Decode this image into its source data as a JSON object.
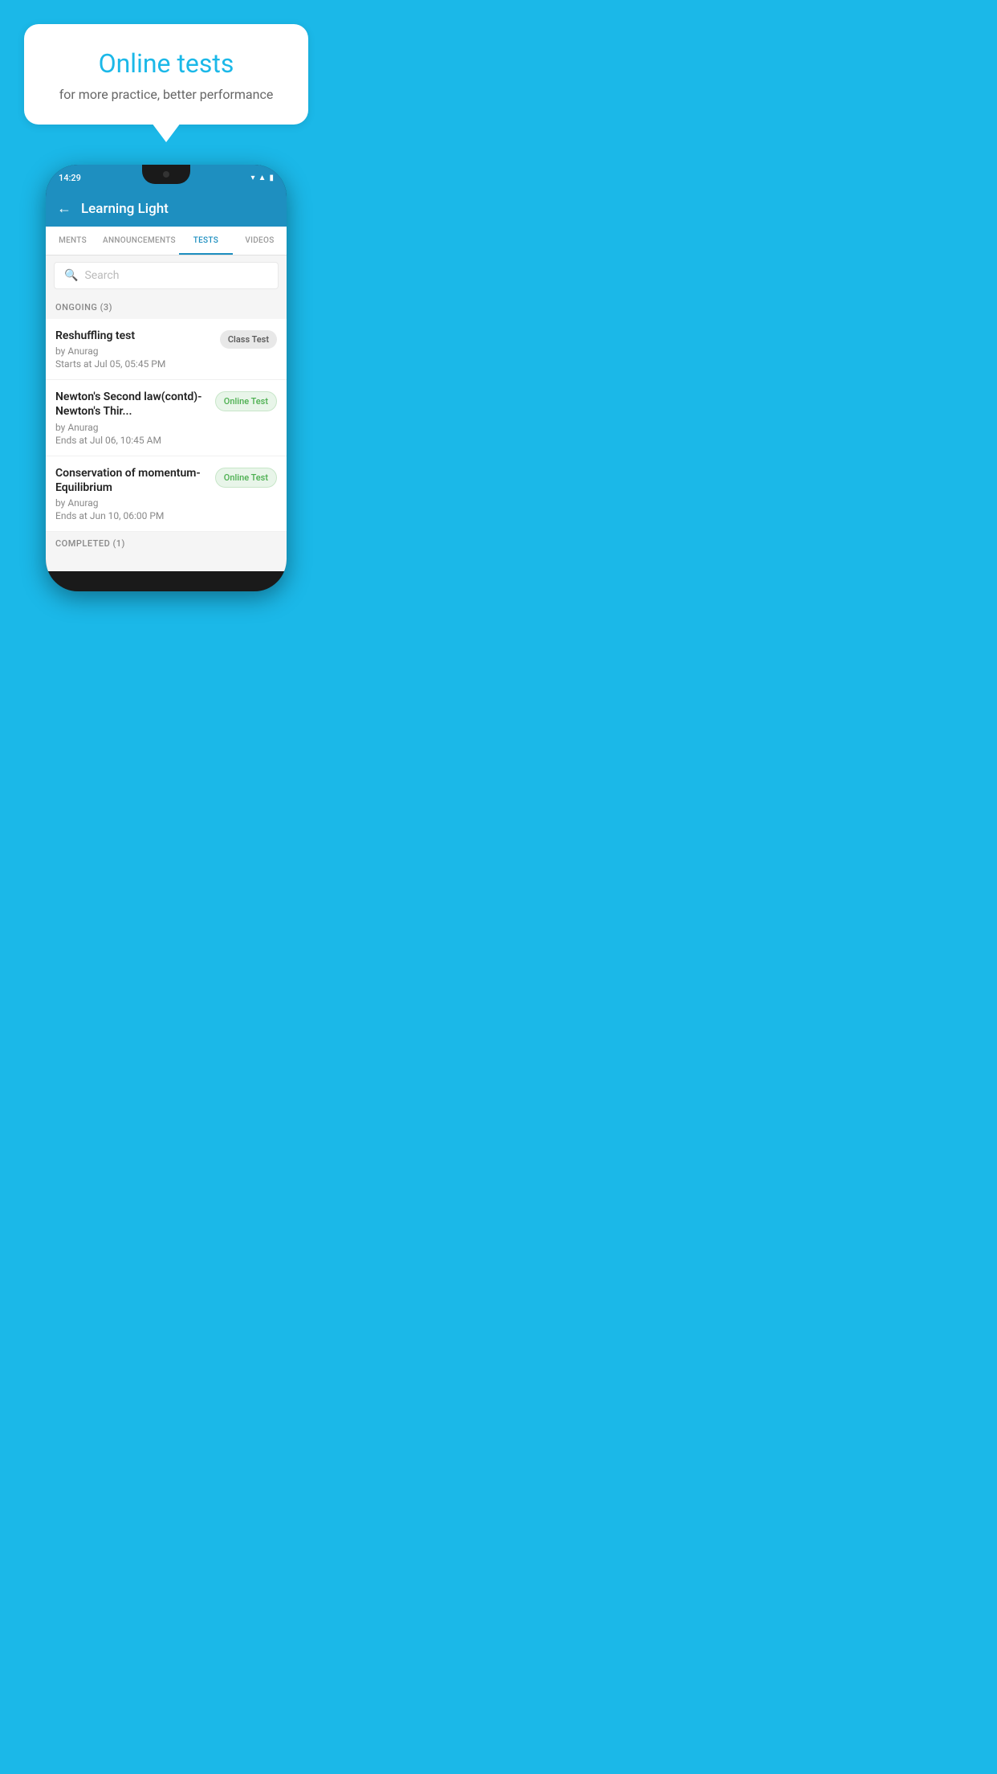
{
  "background": {
    "color": "#1bb8e8"
  },
  "speech_bubble": {
    "title": "Online tests",
    "subtitle": "for more practice, better performance"
  },
  "phone": {
    "status_bar": {
      "time": "14:29",
      "icons": [
        "wifi",
        "signal",
        "battery"
      ]
    },
    "app_bar": {
      "title": "Learning Light",
      "back_label": "←"
    },
    "tabs": [
      {
        "label": "MENTS",
        "active": false
      },
      {
        "label": "ANNOUNCEMENTS",
        "active": false
      },
      {
        "label": "TESTS",
        "active": true
      },
      {
        "label": "VIDEOS",
        "active": false
      }
    ],
    "search": {
      "placeholder": "Search"
    },
    "ongoing_section": {
      "header": "ONGOING (3)",
      "items": [
        {
          "name": "Reshuffling test",
          "by": "by Anurag",
          "time_label": "Starts at",
          "time": "Jul 05, 05:45 PM",
          "badge": "Class Test",
          "badge_type": "class"
        },
        {
          "name": "Newton's Second law(contd)-Newton's Thir...",
          "by": "by Anurag",
          "time_label": "Ends at",
          "time": "Jul 06, 10:45 AM",
          "badge": "Online Test",
          "badge_type": "online"
        },
        {
          "name": "Conservation of momentum-Equilibrium",
          "by": "by Anurag",
          "time_label": "Ends at",
          "time": "Jun 10, 06:00 PM",
          "badge": "Online Test",
          "badge_type": "online"
        }
      ]
    },
    "completed_section": {
      "header": "COMPLETED (1)"
    }
  }
}
